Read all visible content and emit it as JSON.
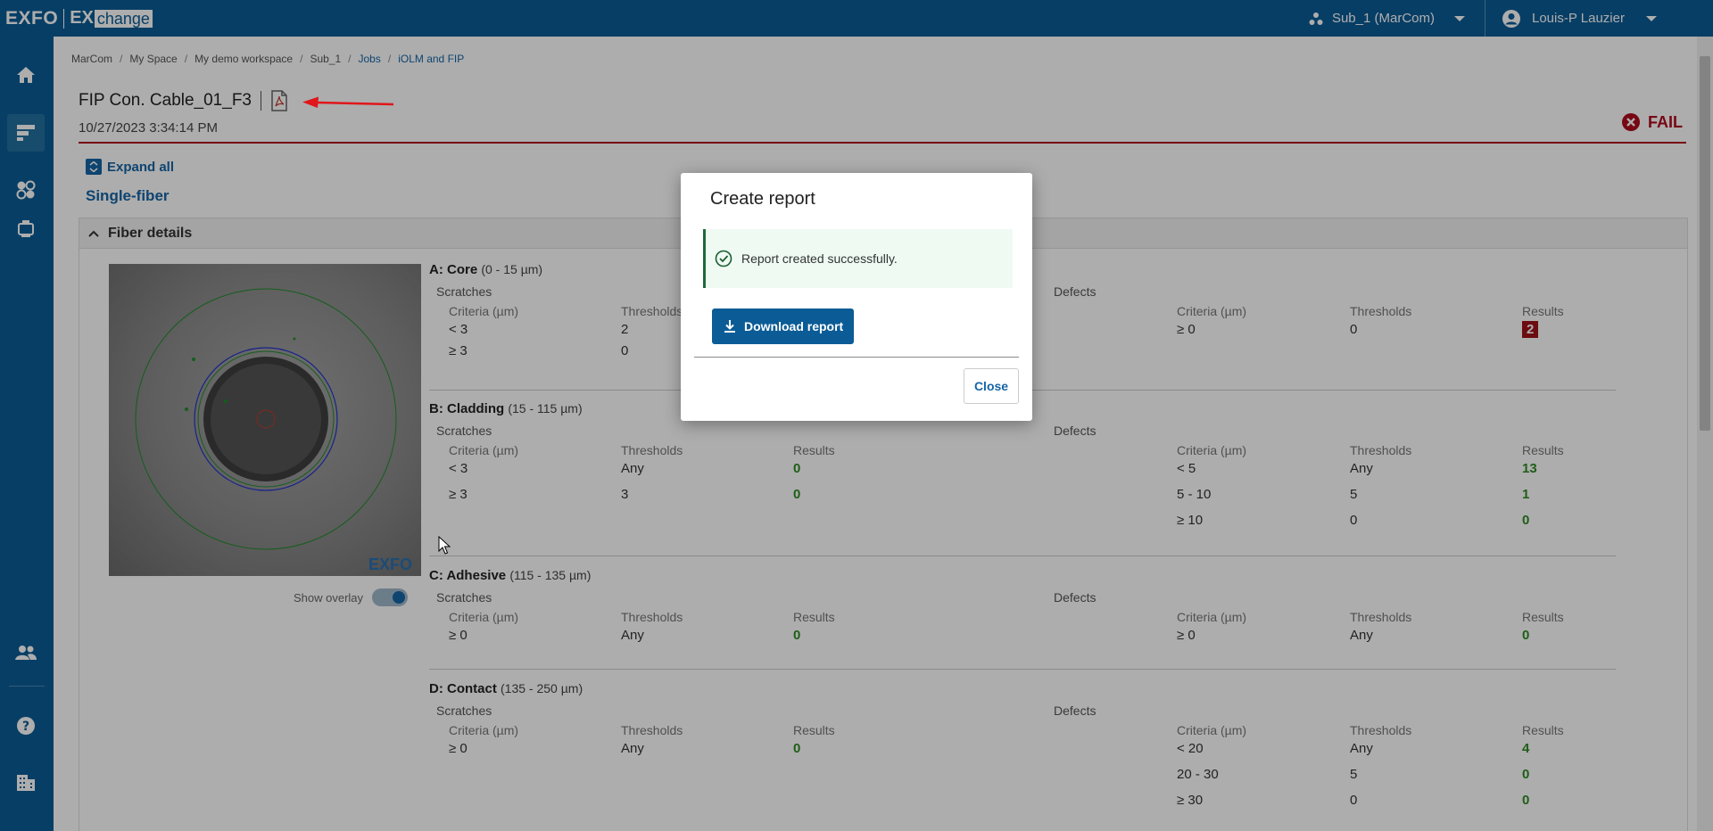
{
  "brand": {
    "logo_main": "EXFO",
    "logo_ex": "EX",
    "logo_change": "change"
  },
  "topbar": {
    "org": "Sub_1 (MarCom)",
    "user": "Louis-P Lauzier"
  },
  "sidebar": {
    "items": [
      "home-icon",
      "jobs-icon",
      "assets-icon",
      "devices-icon",
      "users-icon",
      "help-icon",
      "organization-icon"
    ]
  },
  "breadcrumb": [
    "MarCom",
    "My Space",
    "My demo workspace",
    "Sub_1",
    "Jobs",
    "iOLM and FIP"
  ],
  "header": {
    "title": "FIP Con. Cable_01_F3",
    "timestamp": "10/27/2023 3:34:14 PM",
    "status": "FAIL"
  },
  "controls": {
    "expand_all": "Expand all",
    "section": "Single-fiber",
    "panel_title": "Fiber details",
    "show_overlay": "Show overlay"
  },
  "image": {
    "watermark": "EXFO"
  },
  "labels": {
    "scratches": "Scratches",
    "defects": "Defects",
    "criteria": "Criteria (µm)",
    "thresholds": "Thresholds",
    "results": "Results"
  },
  "zones": {
    "a": {
      "name": "A: Core",
      "range": "(0 - 15 µm)",
      "scratches": [
        [
          "< 3",
          "2",
          ""
        ],
        [
          "≥ 3",
          "0",
          ""
        ]
      ],
      "defects": [
        [
          "≥ 0",
          "0",
          "2"
        ]
      ]
    },
    "b": {
      "name": "B: Cladding",
      "range": "(15 - 115 µm)",
      "scratches": [
        [
          "< 3",
          "Any",
          "0"
        ],
        [
          "≥ 3",
          "3",
          "0"
        ]
      ],
      "defects": [
        [
          "< 5",
          "Any",
          "13"
        ],
        [
          "5 - 10",
          "5",
          "1"
        ],
        [
          "≥ 10",
          "0",
          "0"
        ]
      ]
    },
    "c": {
      "name": "C: Adhesive",
      "range": "(115 - 135 µm)",
      "scratches": [
        [
          "≥ 0",
          "Any",
          "0"
        ]
      ],
      "defects": [
        [
          "≥ 0",
          "Any",
          "0"
        ]
      ]
    },
    "d": {
      "name": "D: Contact",
      "range": "(135 - 250 µm)",
      "scratches": [
        [
          "≥ 0",
          "Any",
          "0"
        ]
      ],
      "defects": [
        [
          "< 20",
          "Any",
          "4"
        ],
        [
          "20 - 30",
          "5",
          "0"
        ],
        [
          "≥ 30",
          "0",
          "0"
        ]
      ]
    }
  },
  "modal": {
    "title": "Create report",
    "message": "Report created successfully.",
    "download": "Download report",
    "close": "Close"
  },
  "colors": {
    "brand": "#0b5c96",
    "fail": "#b00b1e",
    "pass": "#2e8b22"
  }
}
